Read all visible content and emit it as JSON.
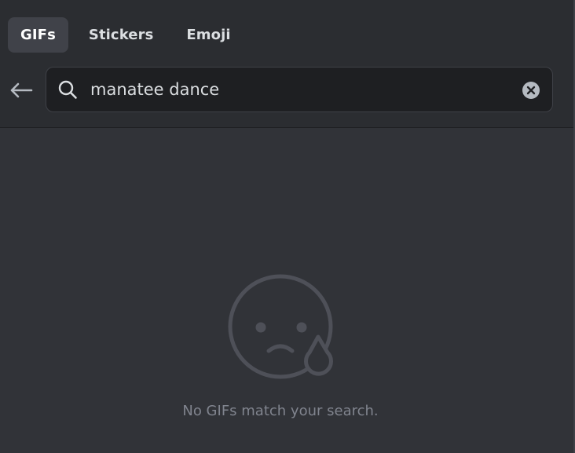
{
  "tabs": [
    {
      "label": "GIFs",
      "active": true
    },
    {
      "label": "Stickers",
      "active": false
    },
    {
      "label": "Emoji",
      "active": false
    }
  ],
  "search": {
    "value": "manatee dance",
    "icon": "search-icon",
    "clear_icon": "clear-circle-icon"
  },
  "back_icon": "arrow-left-icon",
  "empty_state": {
    "icon": "sad-face-tear-icon",
    "message": "No GIFs match your search."
  },
  "colors": {
    "background": "#313338",
    "header": "#2b2d31",
    "input": "#1e1f22",
    "active_tab": "#404249",
    "muted_text": "#80848e"
  }
}
